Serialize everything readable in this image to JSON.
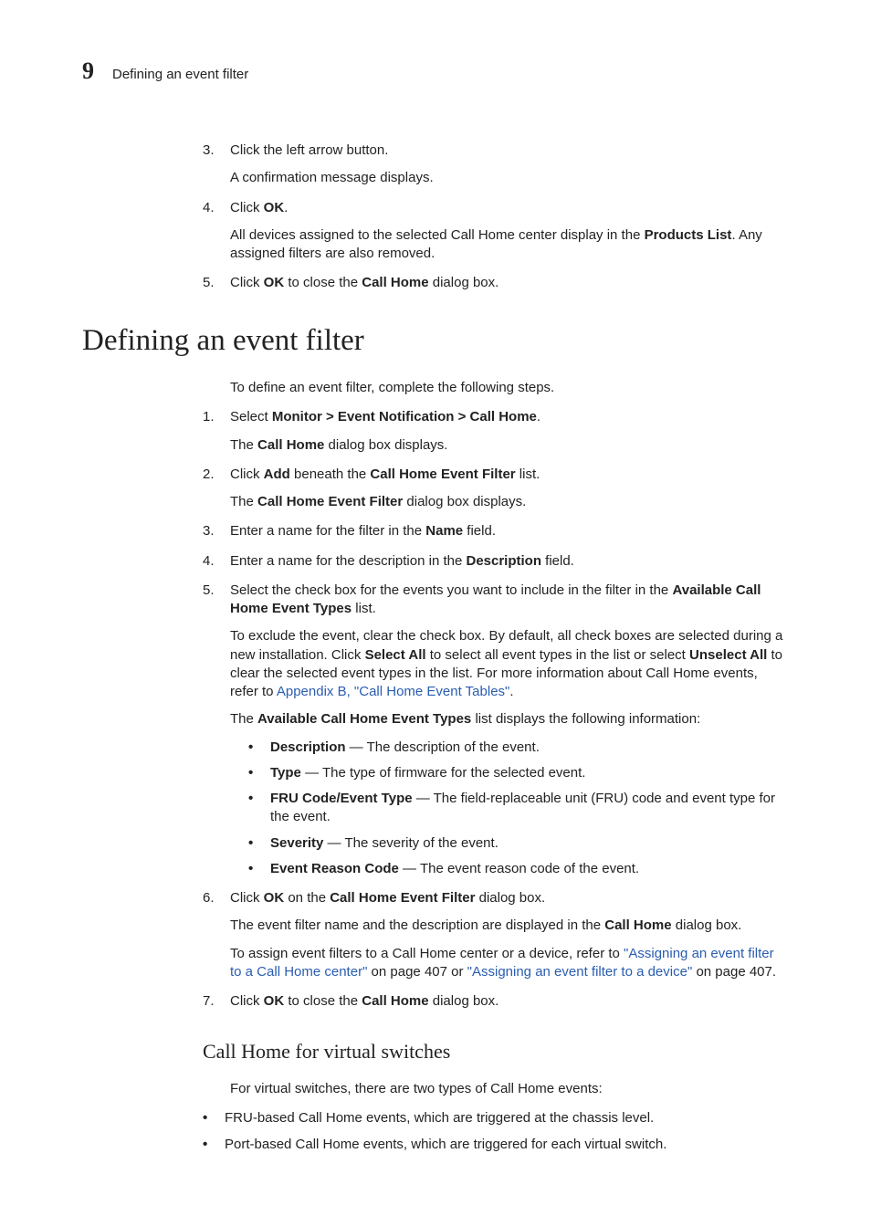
{
  "header": {
    "chapter_number": "9",
    "chapter_title": "Defining an event filter"
  },
  "top_steps": [
    {
      "num": "3.",
      "text_segments": [
        {
          "t": "Click the left arrow button."
        }
      ],
      "para_segments": [
        {
          "t": "A confirmation message displays."
        }
      ]
    },
    {
      "num": "4.",
      "text_segments": [
        {
          "t": "Click "
        },
        {
          "t": "OK",
          "b": true
        },
        {
          "t": "."
        }
      ],
      "para_segments": [
        {
          "t": "All devices assigned to the selected Call Home center display in the "
        },
        {
          "t": "Products List",
          "b": true
        },
        {
          "t": ". Any assigned filters are also removed."
        }
      ]
    },
    {
      "num": "5.",
      "text_segments": [
        {
          "t": "Click "
        },
        {
          "t": "OK",
          "b": true
        },
        {
          "t": " to close the "
        },
        {
          "t": "Call Home",
          "b": true
        },
        {
          "t": " dialog box."
        }
      ]
    }
  ],
  "section": {
    "title": "Defining an event filter",
    "intro": "To define an event filter, complete the following steps.",
    "steps": [
      {
        "num": "1.",
        "text_segments": [
          {
            "t": "Select "
          },
          {
            "t": "Monitor > Event Notification > Call Home",
            "b": true
          },
          {
            "t": "."
          }
        ],
        "paras": [
          [
            {
              "t": "The "
            },
            {
              "t": "Call Home",
              "b": true
            },
            {
              "t": " dialog box displays."
            }
          ]
        ]
      },
      {
        "num": "2.",
        "text_segments": [
          {
            "t": "Click "
          },
          {
            "t": "Add",
            "b": true
          },
          {
            "t": " beneath the "
          },
          {
            "t": "Call Home Event Filter",
            "b": true
          },
          {
            "t": " list."
          }
        ],
        "paras": [
          [
            {
              "t": "The "
            },
            {
              "t": "Call Home Event Filter",
              "b": true
            },
            {
              "t": " dialog box displays."
            }
          ]
        ]
      },
      {
        "num": "3.",
        "text_segments": [
          {
            "t": "Enter a name for the filter in the "
          },
          {
            "t": "Name",
            "b": true
          },
          {
            "t": " field."
          }
        ]
      },
      {
        "num": "4.",
        "text_segments": [
          {
            "t": "Enter a name for the description in the "
          },
          {
            "t": "Description",
            "b": true
          },
          {
            "t": " field."
          }
        ]
      },
      {
        "num": "5.",
        "text_segments": [
          {
            "t": "Select the check box for the events you want to include in the filter in the "
          },
          {
            "t": "Available Call Home Event Types",
            "b": true
          },
          {
            "t": " list."
          }
        ],
        "paras": [
          [
            {
              "t": "To exclude the event, clear the check box. By default, all check boxes are selected during a new installation. Click "
            },
            {
              "t": "Select All",
              "b": true
            },
            {
              "t": " to select all event types in the list or select "
            },
            {
              "t": "Unselect All",
              "b": true
            },
            {
              "t": " to clear the selected event types in the list. For more information about Call Home events, refer to "
            },
            {
              "t": "Appendix B, \"Call Home Event Tables\"",
              "link": true
            },
            {
              "t": "."
            }
          ],
          [
            {
              "t": "The "
            },
            {
              "t": "Available Call Home Event Types",
              "b": true
            },
            {
              "t": " list displays the following information:"
            }
          ]
        ],
        "bullets": [
          [
            {
              "t": "Description",
              "b": true
            },
            {
              "t": " — The description of the event."
            }
          ],
          [
            {
              "t": "Type",
              "b": true
            },
            {
              "t": " — The type of firmware for the selected event."
            }
          ],
          [
            {
              "t": "FRU Code/Event Type",
              "b": true
            },
            {
              "t": " — The field-replaceable unit (FRU) code and event type for the event."
            }
          ],
          [
            {
              "t": "Severity",
              "b": true
            },
            {
              "t": " — The severity of the event."
            }
          ],
          [
            {
              "t": "Event Reason Code",
              "b": true
            },
            {
              "t": " — The event reason code of the event."
            }
          ]
        ]
      },
      {
        "num": "6.",
        "text_segments": [
          {
            "t": "Click "
          },
          {
            "t": "OK",
            "b": true
          },
          {
            "t": " on the "
          },
          {
            "t": "Call Home Event Filter",
            "b": true
          },
          {
            "t": " dialog box."
          }
        ],
        "paras": [
          [
            {
              "t": "The event filter name and the description are displayed in the "
            },
            {
              "t": "Call Home",
              "b": true
            },
            {
              "t": " dialog box."
            }
          ],
          [
            {
              "t": "To assign event filters to a Call Home center or a device, refer to "
            },
            {
              "t": "\"Assigning an event filter to a Call Home center\"",
              "link": true
            },
            {
              "t": " on page 407 or "
            },
            {
              "t": "\"Assigning an event filter to a device\"",
              "link": true
            },
            {
              "t": " on page 407."
            }
          ]
        ]
      },
      {
        "num": "7.",
        "text_segments": [
          {
            "t": "Click "
          },
          {
            "t": "OK",
            "b": true
          },
          {
            "t": " to close the "
          },
          {
            "t": "Call Home",
            "b": true
          },
          {
            "t": " dialog box."
          }
        ]
      }
    ]
  },
  "subsection": {
    "title": "Call Home for virtual switches",
    "intro": "For virtual switches, there are two types of Call Home events:",
    "bullets": [
      [
        {
          "t": "FRU-based Call Home events, which are triggered at the chassis level."
        }
      ],
      [
        {
          "t": "Port-based Call Home events, which are triggered for each virtual switch."
        }
      ]
    ]
  }
}
